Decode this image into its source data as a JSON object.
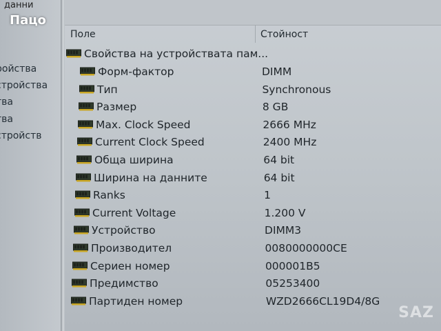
{
  "left_pane": {
    "header": "данни",
    "items": [
      {
        "label": "ройства"
      },
      {
        "label": "стройства"
      },
      {
        "label": "тва"
      },
      {
        "label": "тва"
      },
      {
        "label": "стройств"
      }
    ]
  },
  "overlay_user": "Пацо",
  "columns": {
    "field": "Поле",
    "value": "Стойност"
  },
  "group": {
    "label": "Свойства на устройствата пам...",
    "icon": "memory-module-icon"
  },
  "rows": [
    {
      "label": "Форм-фактор",
      "value": "DIMM",
      "icon": "memory-module-icon"
    },
    {
      "label": "Тип",
      "value": "Synchronous",
      "icon": "memory-module-icon"
    },
    {
      "label": "Размер",
      "value": "8 GB",
      "icon": "memory-module-icon"
    },
    {
      "label": "Max. Clock Speed",
      "value": "2666 MHz",
      "icon": "memory-module-icon"
    },
    {
      "label": "Current Clock Speed",
      "value": "2400 MHz",
      "icon": "memory-module-icon"
    },
    {
      "label": "Обща ширина",
      "value": "64 bit",
      "icon": "memory-module-icon"
    },
    {
      "label": "Ширина на данните",
      "value": "64 bit",
      "icon": "memory-module-icon"
    },
    {
      "label": "Ranks",
      "value": "1",
      "icon": "memory-module-icon"
    },
    {
      "label": "Current Voltage",
      "value": "1.200 V",
      "icon": "memory-module-icon"
    },
    {
      "label": "Устройство",
      "value": "DIMM3",
      "icon": "memory-module-icon"
    },
    {
      "label": "Производител",
      "value": "0080000000CE",
      "icon": "memory-module-icon"
    },
    {
      "label": "Сериен номер",
      "value": "000001B5",
      "icon": "memory-module-icon"
    },
    {
      "label": "Предимство",
      "value": "05253400",
      "icon": "memory-module-icon"
    },
    {
      "label": "Партиден номер",
      "value": "WZD2666CL19D4/8G",
      "icon": "memory-module-icon"
    }
  ],
  "watermark": "SAZ"
}
